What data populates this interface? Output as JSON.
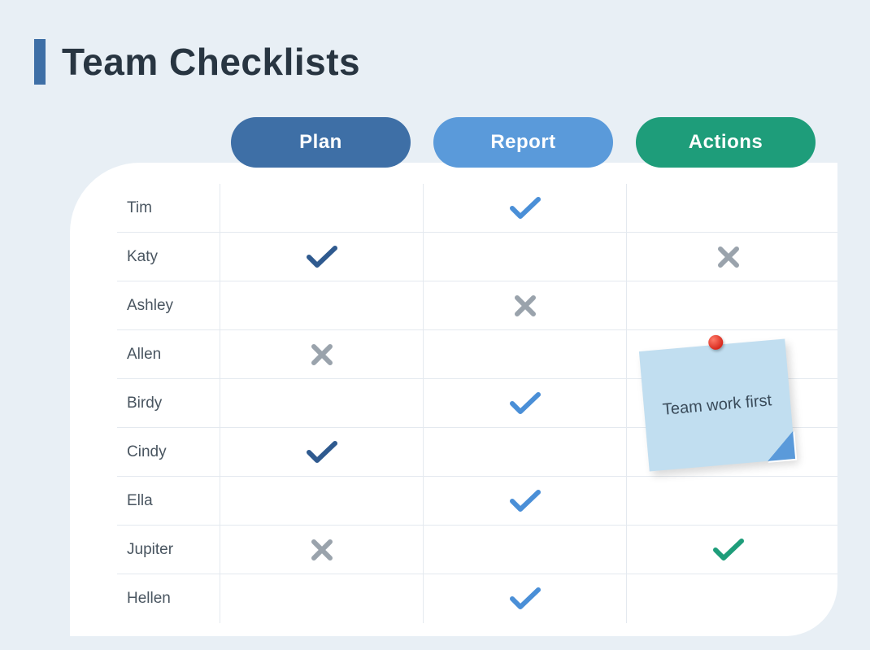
{
  "title": "Team Checklists",
  "columns": {
    "plan": "Plan",
    "report": "Report",
    "actions": "Actions"
  },
  "rows": [
    {
      "name": "Tim",
      "plan": "",
      "report": "check-blue",
      "actions": ""
    },
    {
      "name": "Katy",
      "plan": "check-dark",
      "report": "",
      "actions": "cross"
    },
    {
      "name": "Ashley",
      "plan": "",
      "report": "cross",
      "actions": ""
    },
    {
      "name": "Allen",
      "plan": "cross",
      "report": "",
      "actions": ""
    },
    {
      "name": "Birdy",
      "plan": "",
      "report": "check-blue",
      "actions": ""
    },
    {
      "name": "Cindy",
      "plan": "check-dark",
      "report": "",
      "actions": ""
    },
    {
      "name": "Ella",
      "plan": "",
      "report": "check-blue",
      "actions": ""
    },
    {
      "name": "Jupiter",
      "plan": "cross",
      "report": "",
      "actions": "check-green"
    },
    {
      "name": "Hellen",
      "plan": "",
      "report": "check-blue",
      "actions": ""
    }
  ],
  "sticky": {
    "text": "Team work first"
  },
  "colors": {
    "check_dark": "#2f5a8f",
    "check_blue": "#4a8fd7",
    "check_green": "#1e9d7a",
    "cross": "#9aa3ac"
  }
}
